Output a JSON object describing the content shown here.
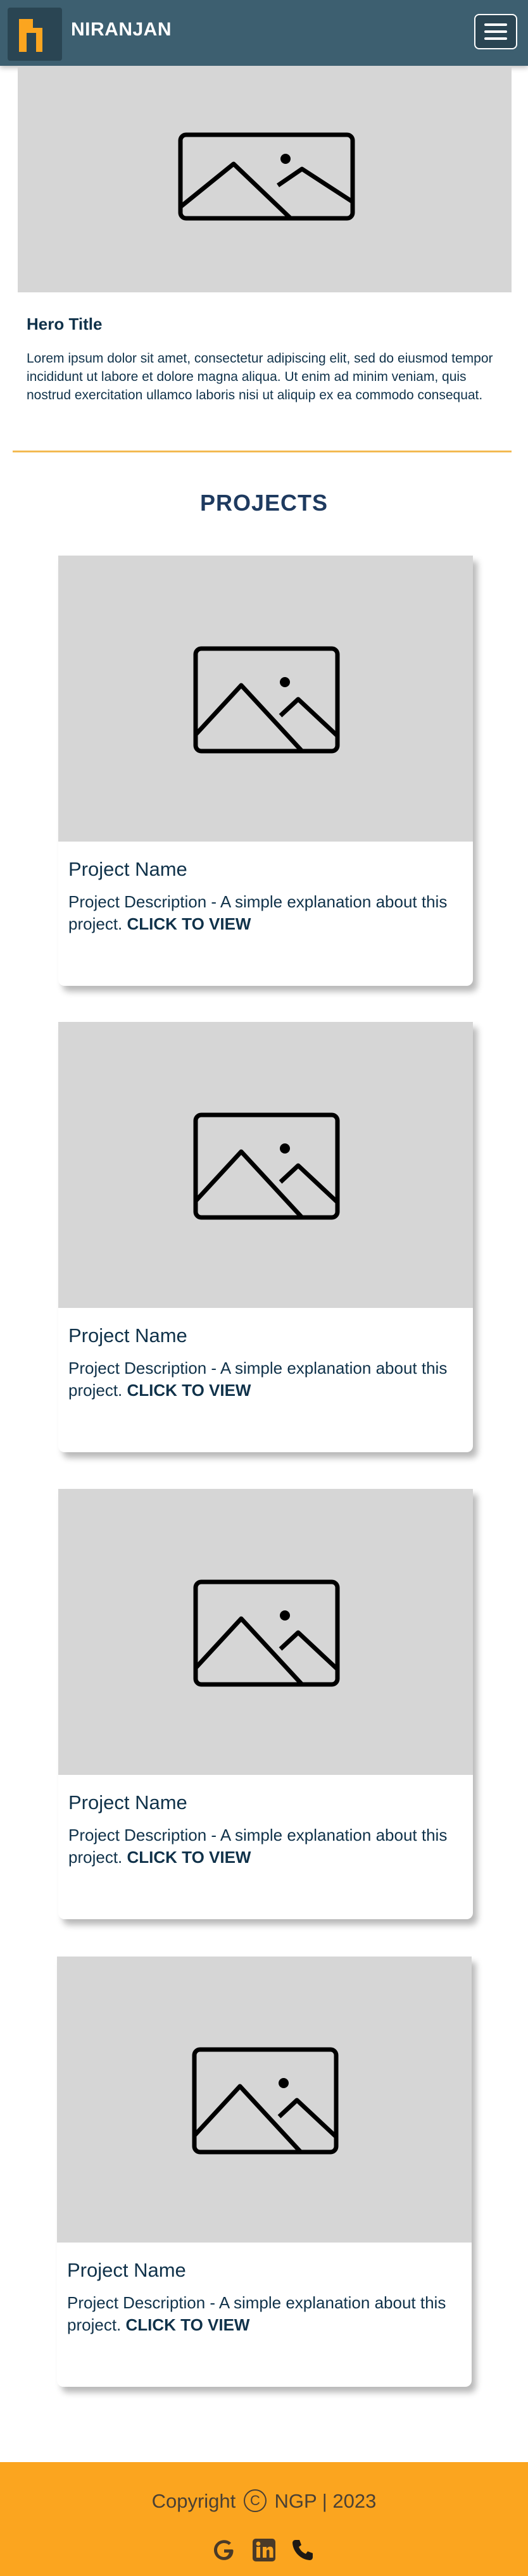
{
  "header": {
    "brand_name": "NIRANJAN",
    "logo_icon": "logo-n-icon",
    "menu_icon": "hamburger-menu-icon",
    "colors": {
      "bar": "#3d5f70",
      "logo_bg": "#2a4553",
      "logo_accent": "#fba51f"
    }
  },
  "hero": {
    "image_icon": "image-placeholder-icon",
    "title": "Hero Title",
    "text": "Lorem ipsum dolor sit amet, consectetur adipiscing elit, sed do eiusmod tempor incididunt ut labore et dolore magna aliqua. Ut enim ad minim veniam, quis nostrud exercitation ullamco laboris nisi ut aliquip ex ea commodo consequat."
  },
  "projects": {
    "section_title": "PROJECTS",
    "items": [
      {
        "name": "Project Name",
        "description": "Project Description - A simple explanation about this project.",
        "link_label": "CLICK TO VIEW"
      },
      {
        "name": "Project Name",
        "description": "Project Description - A simple explanation about this project.",
        "link_label": "CLICK TO VIEW"
      },
      {
        "name": "Project Name",
        "description": "Project Description - A simple explanation about this project.",
        "link_label": "CLICK TO VIEW"
      },
      {
        "name": "Project Name",
        "description": "Project Description - A simple explanation about this project.",
        "link_label": "CLICK TO VIEW"
      }
    ]
  },
  "footer": {
    "copyright_label": "Copyright",
    "copyright_symbol": "C",
    "copyright_text": "NGP | 2023",
    "social_icons": [
      "google-icon",
      "linkedin-icon",
      "phone-icon"
    ],
    "colors": {
      "background": "#fba51f",
      "text": "#4a4034"
    }
  }
}
